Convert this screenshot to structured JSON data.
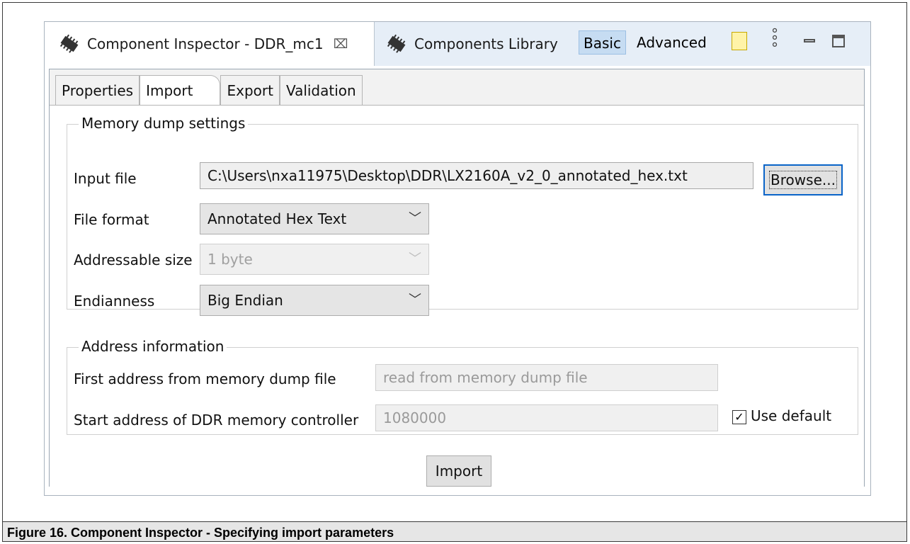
{
  "tabs": {
    "active_label": "Component Inspector - DDR_mc1",
    "inactive_label": "Components Library",
    "close_glyph": "⌧"
  },
  "modes": {
    "basic": "Basic",
    "advanced": "Advanced"
  },
  "subtabs": [
    "Properties",
    "Import",
    "Export",
    "Validation"
  ],
  "memory_dump": {
    "legend": "Memory dump settings",
    "input_file_label": "Input file",
    "input_file_value": "C:\\Users\\nxa11975\\Desktop\\DDR\\LX2160A_v2_0_annotated_hex.txt",
    "browse_label": "Browse...",
    "file_format_label": "File format",
    "file_format_value": "Annotated Hex Text",
    "addressable_size_label": "Addressable size",
    "addressable_size_value": "1 byte",
    "endianness_label": "Endianness",
    "endianness_value": "Big Endian"
  },
  "address_info": {
    "legend": "Address information",
    "first_address_label": "First address from memory dump file",
    "first_address_value": "read from memory dump file",
    "start_address_label": "Start address of DDR memory controller",
    "start_address_value": "1080000",
    "use_default_label": "Use default",
    "use_default_checked": "✓"
  },
  "import_label": "Import",
  "caption": "Figure 16. Component Inspector - Specifying import parameters"
}
